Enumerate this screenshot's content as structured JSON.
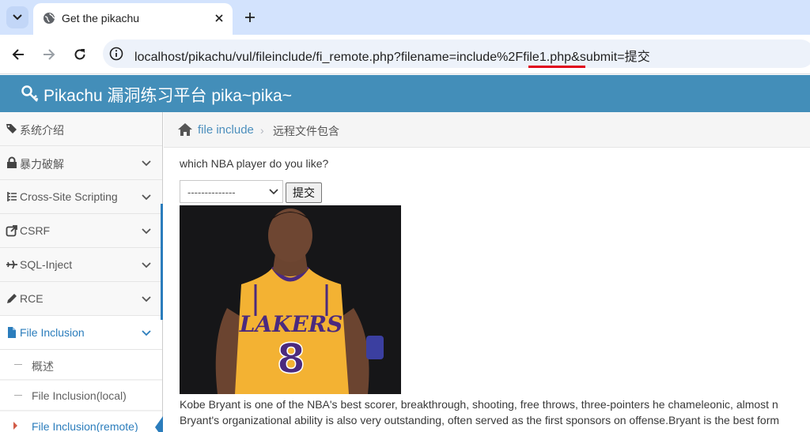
{
  "browser": {
    "tab_title": "Get the pikachu",
    "url": "localhost/pikachu/vul/fileinclude/fi_remote.php?filename=include%2Ffile1.php&submit=提交"
  },
  "site": {
    "title": "Pikachu 漏洞练习平台 pika~pika~",
    "accent_color": "#438eb9",
    "link_color": "#2b7dbc"
  },
  "sidebar": {
    "items": [
      {
        "label": "系统介绍",
        "icon": "tags-icon"
      },
      {
        "label": "暴力破解",
        "icon": "lock-icon"
      },
      {
        "label": "Cross-Site Scripting",
        "icon": "list-icon"
      },
      {
        "label": "CSRF",
        "icon": "share-icon"
      },
      {
        "label": "SQL-Inject",
        "icon": "plane-icon"
      },
      {
        "label": "RCE",
        "icon": "pencil-icon"
      },
      {
        "label": "File Inclusion",
        "icon": "file-icon"
      }
    ],
    "sub_items": [
      {
        "label": "概述"
      },
      {
        "label": "File Inclusion(local)"
      },
      {
        "label": "File Inclusion(remote)"
      }
    ]
  },
  "breadcrumb": {
    "link": "file include",
    "separator": "›",
    "current": "远程文件包含"
  },
  "main": {
    "question": "which NBA player do you like?",
    "select_value": "--------------",
    "submit_label": "提交",
    "description_line1": "Kobe Bryant is one of the NBA's best scorer, breakthrough, shooting, free throws, three-pointers he chameleonic, almost n",
    "description_line2": "Bryant's organizational ability is also very outstanding, often served as the first sponsors on offense.Bryant is the best form"
  }
}
